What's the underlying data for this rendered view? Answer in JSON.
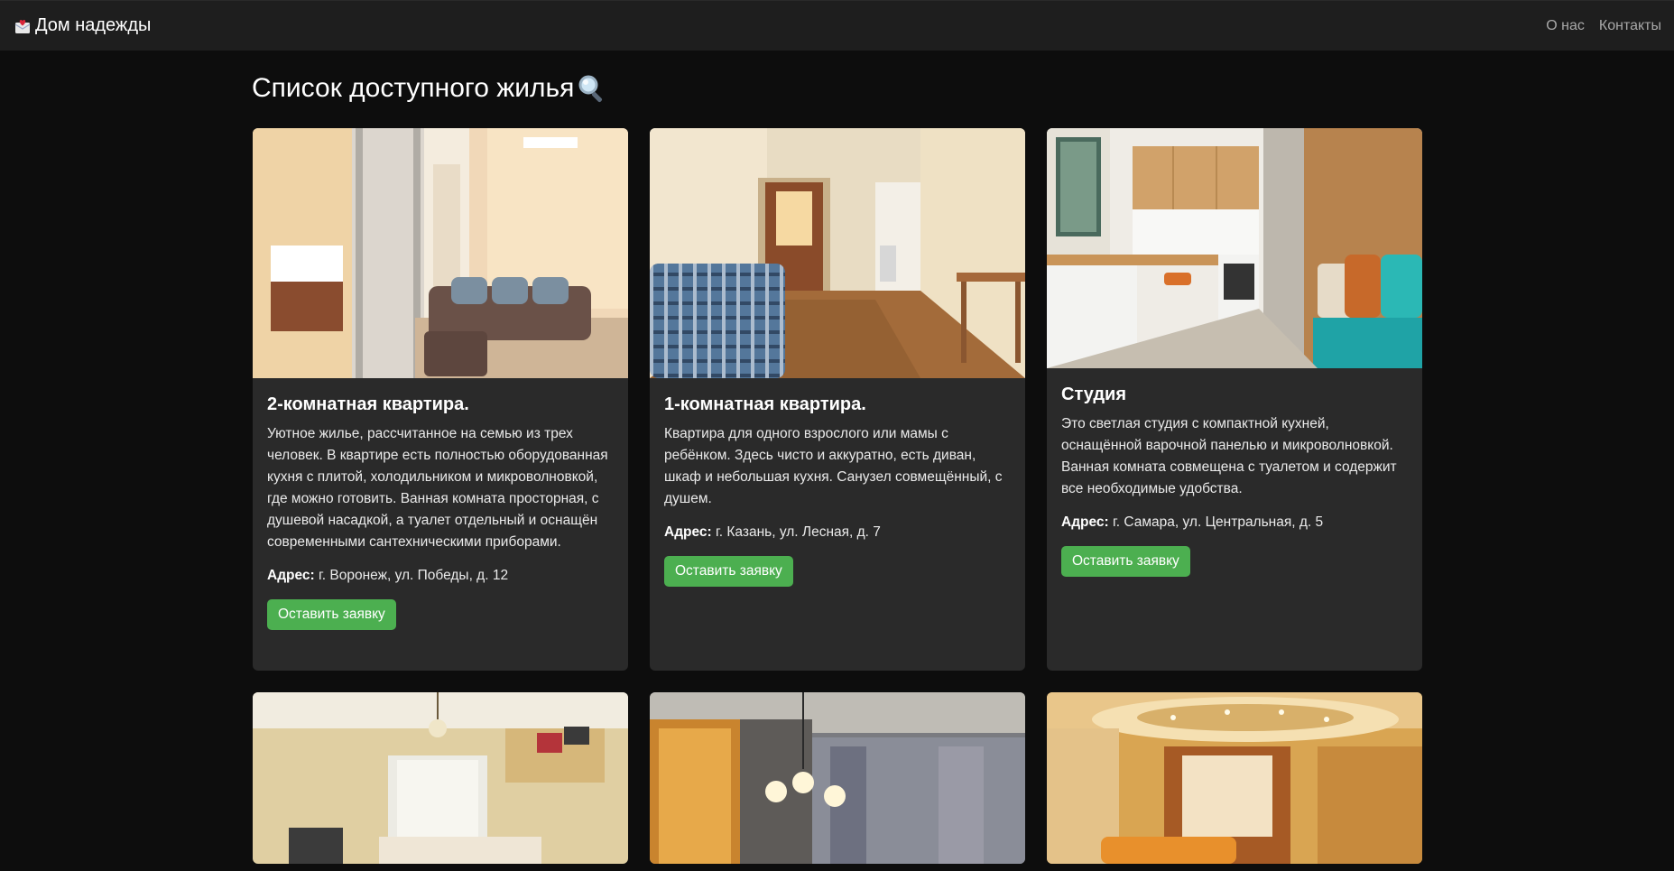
{
  "navbar": {
    "brand": "Дом надежды",
    "links": [
      {
        "label": "О нас"
      },
      {
        "label": "Контакты"
      }
    ]
  },
  "page": {
    "title": "Список доступного жилья"
  },
  "listings": [
    {
      "title": "2-комнатная квартира.",
      "description": "Уютное жилье, рассчитанное на семью из трех человек. В квартире есть полностью оборудованная кухня с плитой, холодильником и микроволновкой, где можно готовить. Ванная комната просторная, с душевой насадкой, а туалет отдельный и оснащён современными сантехническими приборами.",
      "address_label": "Адрес:",
      "address": "г. Воронеж, ул. Победы, д. 12",
      "button": "Оставить заявку"
    },
    {
      "title": "1-комнатная квартира.",
      "description": "Квартира для одного взрослого или мамы с ребёнком. Здесь чисто и аккуратно, есть диван, шкаф и небольшая кухня. Санузел совмещённый, с душем.",
      "address_label": "Адрес:",
      "address": "г. Казань, ул. Лесная, д. 7",
      "button": "Оставить заявку"
    },
    {
      "title": "Студия",
      "description": "Это светлая студия с компактной кухней, оснащённой варочной панелью и микроволновкой. Ванная комната совмещена с туалетом и содержит все необходимые удобства.",
      "address_label": "Адрес:",
      "address": "г. Самара, ул. Центральная, д. 5",
      "button": "Оставить заявку"
    }
  ],
  "colors": {
    "background": "#0d0d0d",
    "navbar": "#1e1e1e",
    "card": "#2a2a2a",
    "button": "#4caf50"
  }
}
